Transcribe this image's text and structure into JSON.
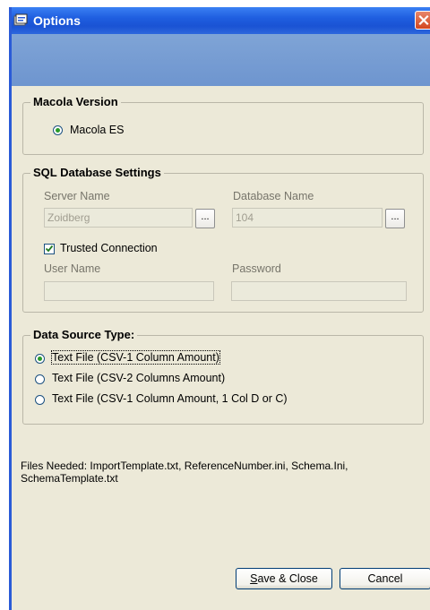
{
  "window": {
    "title": "Options"
  },
  "version_group": {
    "legend": "Macola Version",
    "option": "Macola ES"
  },
  "sql_group": {
    "legend": "SQL Database Settings",
    "server_label": "Server Name",
    "server_value": "Zoidberg",
    "database_label": "Database Name",
    "database_value": "104",
    "browse_label": "...",
    "trusted_label": "Trusted Connection",
    "trusted_checked": true,
    "user_label": "User Name",
    "user_value": "",
    "password_label": "Password",
    "password_value": ""
  },
  "datasource_group": {
    "legend": "Data Source Type:",
    "options": [
      {
        "label": "Text File (CSV-1 Column Amount)",
        "selected": true
      },
      {
        "label": "Text File (CSV-2 Columns Amount)",
        "selected": false
      },
      {
        "label": "Text File (CSV-1 Column Amount, 1 Col D or C)",
        "selected": false
      }
    ]
  },
  "files_needed": {
    "line1": "Files Needed: ImportTemplate.txt, ReferenceNumber.ini, Schema.Ini,",
    "line2": "SchemaTemplate.txt"
  },
  "buttons": {
    "save_prefix": "S",
    "save_rest": "ave & Close",
    "cancel": "Cancel"
  },
  "colors": {
    "titlebar": "#1f5ee0",
    "banner": "#7fa4d6",
    "dialog": "#ece9d8",
    "close": "#d3461f"
  }
}
